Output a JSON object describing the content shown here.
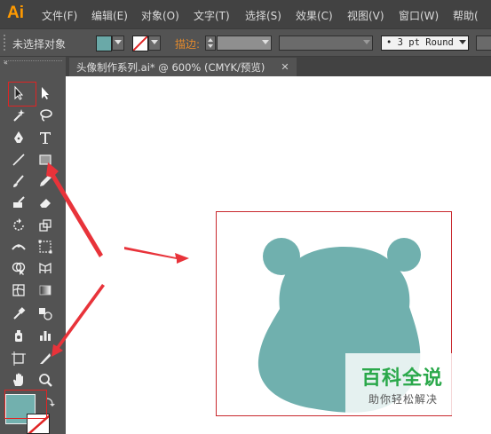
{
  "app": {
    "logo": "Ai"
  },
  "menu": [
    "文件(F)",
    "编辑(E)",
    "对象(O)",
    "文字(T)",
    "选择(S)",
    "效果(C)",
    "视图(V)",
    "窗口(W)",
    "帮助("
  ],
  "control_bar": {
    "selection_status": "未选择对象",
    "stroke_label": "描边:",
    "brush_value": "• 3 pt Round",
    "fill_color": "#6aa9a8"
  },
  "document": {
    "tab_title": "头像制作系列.ai* @ 600% (CMYK/预览)",
    "close_glyph": "✕"
  },
  "toolbox": {
    "fill_color": "#72b0ae"
  },
  "artwork": {
    "shape_color": "#70b0ae",
    "highlight_color": "#e02424"
  },
  "watermark": {
    "title": "百科全说",
    "subtitle": "助你轻松解决"
  }
}
